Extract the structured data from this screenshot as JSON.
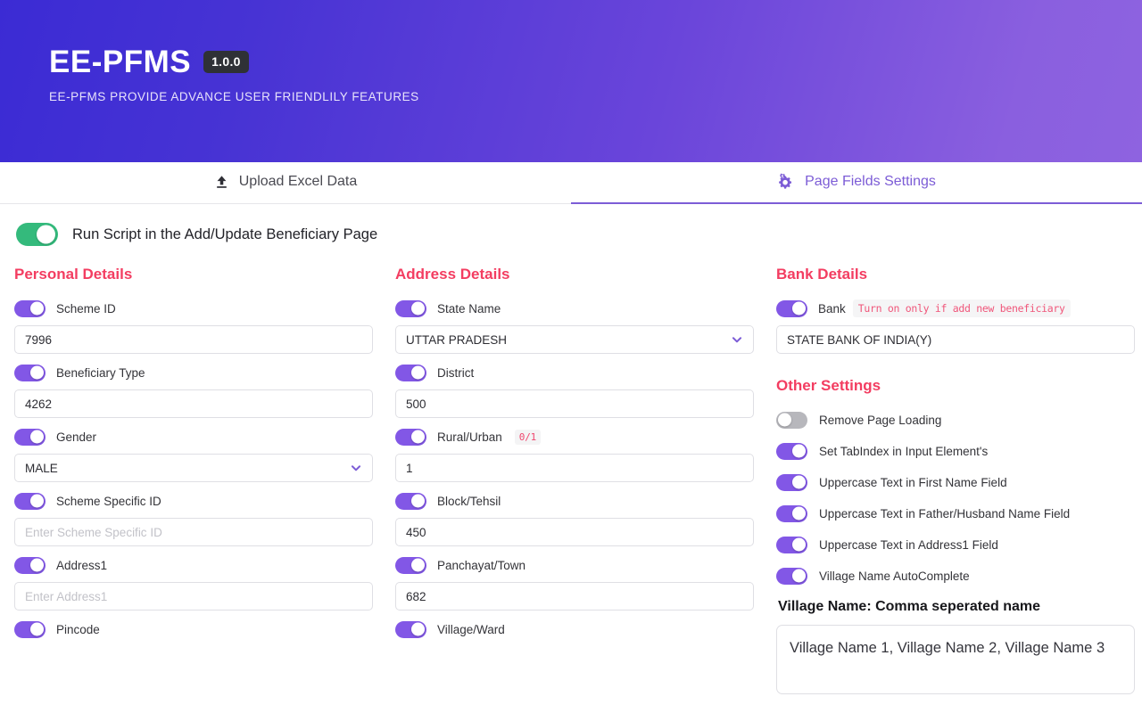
{
  "header": {
    "brand": "EE-PFMS",
    "version": "1.0.0",
    "tagline": "EE-PFMS PROVIDE ADVANCE USER FRIENDLILY FEATURES"
  },
  "tabs": [
    {
      "label": "Upload Excel Data",
      "icon": "upload-icon",
      "active": false
    },
    {
      "label": "Page Fields Settings",
      "icon": "gears-icon",
      "active": true
    }
  ],
  "master_toggle": {
    "label": "Run Script in the Add/Update Beneficiary Page",
    "state": "on",
    "color": "#34ba7c"
  },
  "colors": {
    "accent_purple": "#8257e6",
    "section_pink": "#f33d61",
    "toggle_green": "#34ba7c",
    "toggle_off_gray": "#b7b7bc",
    "tab_active": "#7c5cd6"
  },
  "personal_details": {
    "title": "Personal Details",
    "fields": [
      {
        "label": "Scheme ID",
        "toggle": "on",
        "type": "text",
        "value": "7996",
        "placeholder": ""
      },
      {
        "label": "Beneficiary Type",
        "toggle": "on",
        "type": "text",
        "value": "4262",
        "placeholder": ""
      },
      {
        "label": "Gender",
        "toggle": "on",
        "type": "select",
        "value": "MALE",
        "placeholder": ""
      },
      {
        "label": "Scheme Specific ID",
        "toggle": "on",
        "type": "text",
        "value": "",
        "placeholder": "Enter Scheme Specific ID"
      },
      {
        "label": "Address1",
        "toggle": "on",
        "type": "text",
        "value": "",
        "placeholder": "Enter Address1"
      },
      {
        "label": "Pincode",
        "toggle": "on",
        "type": "none",
        "value": "",
        "placeholder": ""
      }
    ]
  },
  "address_details": {
    "title": "Address Details",
    "fields": [
      {
        "label": "State Name",
        "toggle": "on",
        "type": "select",
        "value": "UTTAR PRADESH",
        "placeholder": ""
      },
      {
        "label": "District",
        "toggle": "on",
        "type": "text",
        "value": "500",
        "placeholder": ""
      },
      {
        "label": "Rural/Urban",
        "badge": "0/1",
        "toggle": "on",
        "type": "text",
        "value": "1",
        "placeholder": ""
      },
      {
        "label": "Block/Tehsil",
        "toggle": "on",
        "type": "text",
        "value": "450",
        "placeholder": ""
      },
      {
        "label": "Panchayat/Town",
        "toggle": "on",
        "type": "text",
        "value": "682",
        "placeholder": ""
      },
      {
        "label": "Village/Ward",
        "toggle": "on",
        "type": "none",
        "value": "",
        "placeholder": ""
      }
    ]
  },
  "bank_details": {
    "title": "Bank Details",
    "field": {
      "label": "Bank",
      "hint": "Turn on only if add new beneficiary",
      "toggle": "on",
      "value": "STATE BANK OF INDIA(Y)"
    }
  },
  "other_settings": {
    "title": "Other Settings",
    "options": [
      {
        "label": "Remove Page Loading",
        "toggle": "off"
      },
      {
        "label": "Set TabIndex in Input Element's",
        "toggle": "on"
      },
      {
        "label": "Uppercase Text in First Name Field",
        "toggle": "on"
      },
      {
        "label": "Uppercase Text in Father/Husband Name Field",
        "toggle": "on"
      },
      {
        "label": "Uppercase Text in Address1 Field",
        "toggle": "on"
      },
      {
        "label": "Village Name AutoComplete",
        "toggle": "on"
      }
    ],
    "village_label": "Village Name: Comma seperated name",
    "village_value": "Village Name 1, Village Name 2, Village Name 3"
  }
}
